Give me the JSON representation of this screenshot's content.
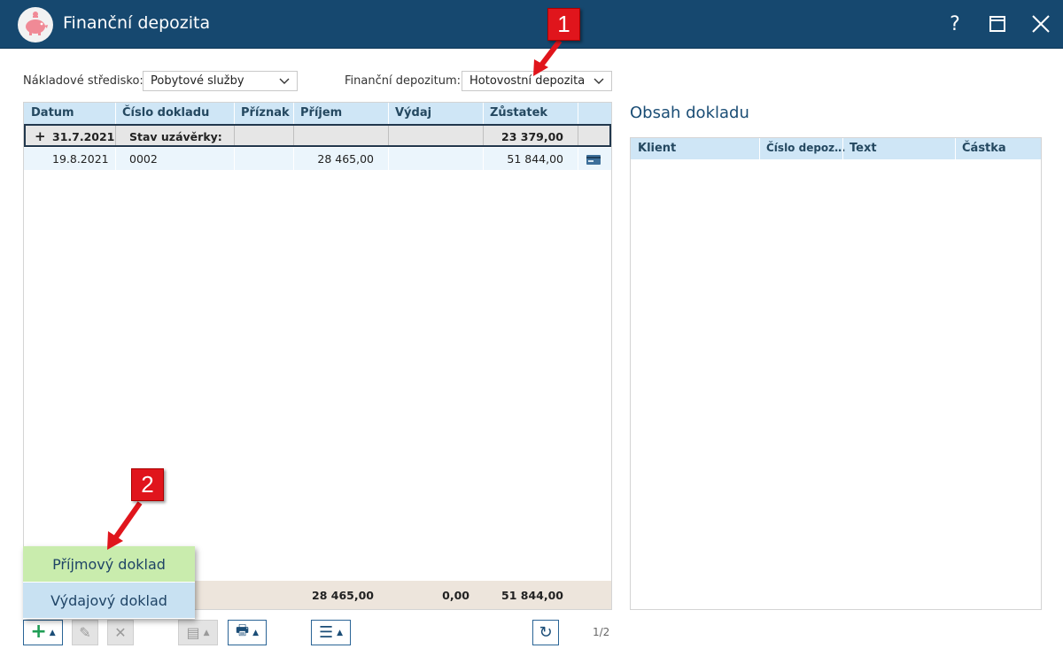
{
  "window": {
    "title": "Finanční depozita",
    "help_label": "?"
  },
  "filters": {
    "cost_center_label": "Nákladové středisko:",
    "cost_center_value": "Pobytové služby",
    "deposit_label": "Finanční depozitum:",
    "deposit_value": "Hotovostní depozita"
  },
  "grid": {
    "columns": [
      "Datum",
      "Číslo dokladu",
      "Příznak",
      "Příjem",
      "Výdaj",
      "Zůstatek"
    ],
    "group_row": {
      "expander": "+",
      "date": "31.7.2021",
      "label": "Stav uzávěrky:",
      "balance": "23 379,00"
    },
    "rows": [
      {
        "date": "19.8.2021",
        "number": "0002",
        "flag": "",
        "income": "28 465,00",
        "expense": "",
        "balance": "51 844,00"
      }
    ],
    "totals": {
      "income": "28 465,00",
      "expense": "0,00",
      "balance": "51 844,00"
    }
  },
  "detail": {
    "title": "Obsah dokladu",
    "columns": [
      "Klient",
      "Číslo depoz…",
      "Text",
      "Částka"
    ]
  },
  "popup_menu": {
    "items": [
      "Příjmový doklad",
      "Výdajový doklad"
    ]
  },
  "pager": "1/2",
  "callouts": [
    "1",
    "2"
  ],
  "colors": {
    "titlebar": "#16486f",
    "header": "#cfe6f6",
    "income_item": "#c9ecad",
    "expense_item": "#c8e1f2",
    "callout": "#e0151c",
    "footer": "#ede5dc"
  }
}
